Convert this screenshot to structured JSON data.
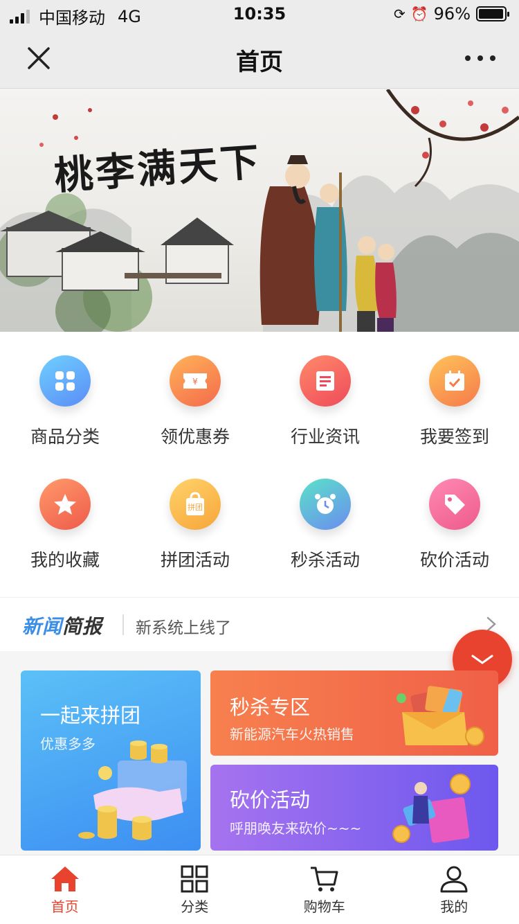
{
  "status_bar": {
    "carrier": "中国移动",
    "network": "4G",
    "time": "10:35",
    "battery": "96%",
    "battery_level": 0.96
  },
  "nav": {
    "title": "首页",
    "close_icon": "close-icon",
    "more_icon": "more-dots-icon"
  },
  "banner": {
    "calligraphy": "桃李满天下"
  },
  "grid": [
    {
      "label": "商品分类",
      "icon": "category-icon",
      "color_a": "#6fd0ff",
      "color_b": "#5b8cf6"
    },
    {
      "label": "领优惠券",
      "icon": "coupon-icon",
      "color_a": "#ffb35a",
      "color_b": "#f46a4a"
    },
    {
      "label": "行业资讯",
      "icon": "news-icon",
      "color_a": "#ff8a6b",
      "color_b": "#ee4a5a"
    },
    {
      "label": "我要签到",
      "icon": "calendar-check-icon",
      "color_a": "#ffc35a",
      "color_b": "#f57a4a"
    },
    {
      "label": "我的收藏",
      "icon": "star-icon",
      "color_a": "#ff9a6b",
      "color_b": "#ee5a4a"
    },
    {
      "label": "拼团活动",
      "icon": "group-bag-icon",
      "color_a": "#ffd36a",
      "color_b": "#f7a53a",
      "icon_text": "拼团"
    },
    {
      "label": "秒杀活动",
      "icon": "alarm-clock-icon",
      "color_a": "#5be2c8",
      "color_b": "#6b8cf0"
    },
    {
      "label": "砍价活动",
      "icon": "price-tag-icon",
      "color_a": "#ff8ab4",
      "color_b": "#ee5a8a"
    }
  ],
  "news": {
    "logo_a": "新闻",
    "logo_b": "简报",
    "headline": "新系统上线了"
  },
  "promo": {
    "group": {
      "title": "一起来拼团",
      "subtitle": "优惠多多"
    },
    "flash": {
      "title": "秒杀专区",
      "subtitle": "新能源汽车火热销售"
    },
    "bargain": {
      "title": "砍价活动",
      "subtitle": "呼朋唤友来砍价~~~"
    }
  },
  "tabs": [
    {
      "label": "首页",
      "icon": "home-icon",
      "active": true
    },
    {
      "label": "分类",
      "icon": "grid-icon",
      "active": false
    },
    {
      "label": "购物车",
      "icon": "cart-icon",
      "active": false
    },
    {
      "label": "我的",
      "icon": "user-icon",
      "active": false
    }
  ],
  "colors": {
    "accent": "#e8432e",
    "news_blue": "#3a8ee6"
  }
}
